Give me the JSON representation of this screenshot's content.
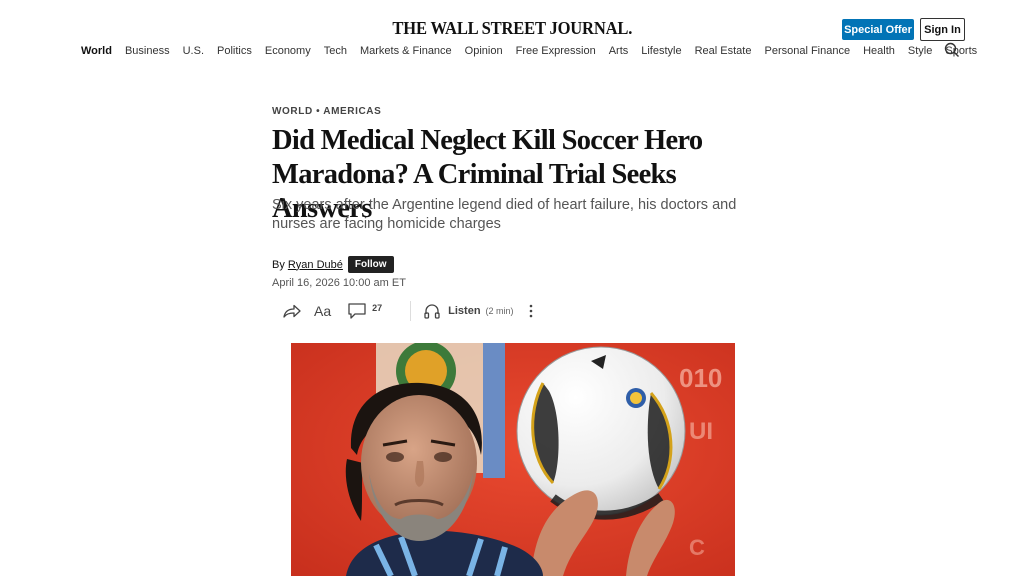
{
  "masthead": {
    "title": "THE WALL STREET JOURNAL."
  },
  "header": {
    "special_offer": "Special Offer",
    "sign_in": "Sign In"
  },
  "nav": {
    "items": [
      {
        "label": "World",
        "active": true
      },
      {
        "label": "Business"
      },
      {
        "label": "U.S."
      },
      {
        "label": "Politics"
      },
      {
        "label": "Economy"
      },
      {
        "label": "Tech"
      },
      {
        "label": "Markets & Finance"
      },
      {
        "label": "Opinion"
      },
      {
        "label": "Free Expression"
      },
      {
        "label": "Arts"
      },
      {
        "label": "Lifestyle"
      },
      {
        "label": "Real Estate"
      },
      {
        "label": "Personal Finance"
      },
      {
        "label": "Health"
      },
      {
        "label": "Style"
      },
      {
        "label": "Sports"
      }
    ],
    "search_icon": "search-icon"
  },
  "article": {
    "kicker": "WORLD • AMERICAS",
    "headline": "Did Medical Neglect Kill Soccer Hero Maradona? A Criminal Trial Seeks Answers",
    "dek": "Six years after the Argentine legend died of heart failure, his doctors and nurses are facing homicide charges",
    "byline_prefix": "By",
    "author": "Ryan Dubé",
    "follow_label": "Follow",
    "date": "April 16, 2026 10:00 am ET"
  },
  "toolbar": {
    "share_icon": "share-icon",
    "text_size_label": "Aa",
    "comment_count": "27",
    "listen_label": "Listen",
    "listen_duration": "(2 min)",
    "more_icon": "more-icon"
  },
  "hero_image": {
    "description_icon": "photo"
  },
  "colors": {
    "accent": "#0274b6",
    "follow_bg": "#222222",
    "photo_bg": "#d93a26"
  }
}
